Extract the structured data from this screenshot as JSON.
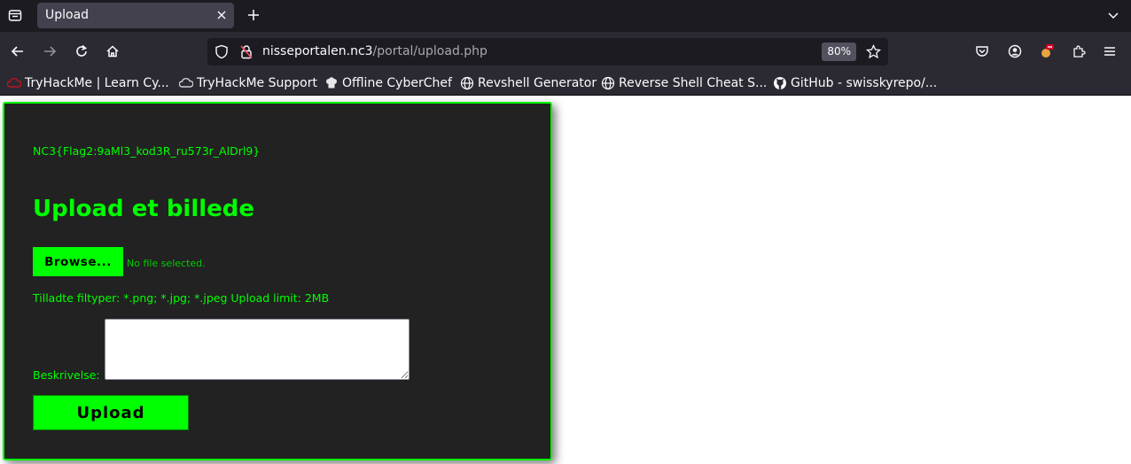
{
  "browser": {
    "tab": {
      "title": "Upload"
    },
    "url": {
      "host": "nisseportalen.nc3",
      "path": "/portal/upload.php"
    },
    "zoom": "80%",
    "bookmarks": [
      {
        "label": "TryHackMe | Learn Cy...",
        "icon": "tryhackme-icon"
      },
      {
        "label": "TryHackMe Support",
        "icon": "cloud-icon"
      },
      {
        "label": "Offline CyberChef",
        "icon": "chef-hat-icon"
      },
      {
        "label": "Revshell Generator",
        "icon": "globe-icon"
      },
      {
        "label": "Reverse Shell Cheat S...",
        "icon": "globe-icon"
      },
      {
        "label": "GitHub - swisskyrepo/...",
        "icon": "github-icon"
      }
    ]
  },
  "page": {
    "flag": "NC3{Flag2:9aMl3_kod3R_ru573r_AlDrl9}",
    "heading": "Upload et billede",
    "browse_label": "Browse...",
    "no_file": "No file selected.",
    "filetypes": "Tilladte filtyper: *.png; *.jpg; *.jpeg Upload limit: 2MB",
    "description_label": "Beskrivelse:",
    "description_value": "",
    "upload_label": "Upload"
  },
  "colors": {
    "accent": "#00ff00",
    "panel": "#222222",
    "chrome": "#2b2a33"
  }
}
